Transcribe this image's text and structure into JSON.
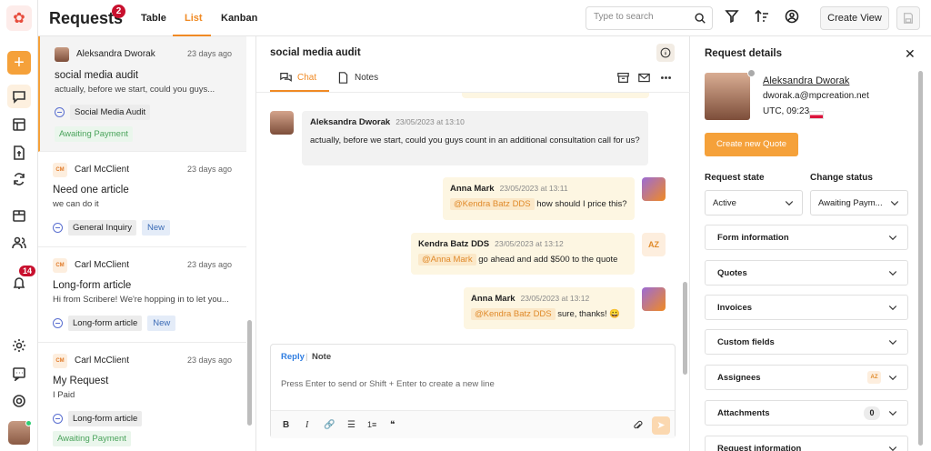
{
  "header": {
    "title": "Requests",
    "title_count": "2",
    "tabs": [
      {
        "label": "Table"
      },
      {
        "label": "List"
      },
      {
        "label": "Kanban"
      }
    ],
    "search_placeholder": "Type to search",
    "create_view_label": "Create View"
  },
  "rail": {
    "notification_count": "14",
    "icons": [
      "logo-icon",
      "plus-icon",
      "chat-icon",
      "layout-icon",
      "invoice-icon",
      "sync-icon",
      "package-icon",
      "users-icon",
      "bell-icon",
      "gear-icon",
      "message-icon",
      "lifebuoy-icon"
    ]
  },
  "requests": [
    {
      "name": "Aleksandra Dworak",
      "ago": "23 days ago",
      "subject": "social media audit",
      "preview": "actually, before we start, could you guys...",
      "category": "Social Media Audit",
      "status": "Awaiting Payment"
    },
    {
      "name": "Carl McClient",
      "avatar": "CM",
      "ago": "23 days ago",
      "subject": "Need one article",
      "preview": "we can do it",
      "category": "General Inquiry",
      "new": "New"
    },
    {
      "name": "Carl McClient",
      "avatar": "CM",
      "ago": "23 days ago",
      "subject": "Long-form article",
      "preview": "Hi from Scribere! We're hopping in to let you...",
      "category": "Long-form article",
      "new": "New"
    },
    {
      "name": "Carl McClient",
      "avatar": "CM",
      "ago": "23 days ago",
      "subject": "My Request",
      "preview": "I Paid",
      "category": "Long-form article",
      "status": "Awaiting Payment"
    }
  ],
  "chat": {
    "title": "social media audit",
    "tabs": [
      {
        "label": "Chat"
      },
      {
        "label": "Notes"
      }
    ],
    "messages": [
      {
        "author": "Aleksandra Dworak",
        "time": "23/05/2023 at 13:10",
        "text": "actually, before we start, could you guys count in an additional consultation call for us?"
      },
      {
        "author": "Anna Mark",
        "time": "23/05/2023 at 13:11",
        "mention": "@Kendra Batz DDS",
        "text": "how should I price this?"
      },
      {
        "author": "Kendra Batz DDS",
        "time": "23/05/2023 at 13:12",
        "mention": "@Anna Mark",
        "text": "go ahead and add $500 to the quote",
        "avatar": "AZ"
      },
      {
        "author": "Anna Mark",
        "time": "23/05/2023 at 13:12",
        "mention": "@Kendra Batz DDS",
        "text": "sure, thanks! 😀"
      }
    ],
    "reply_tab": "Reply",
    "note_tab": "Note",
    "reply_placeholder": "Press Enter to send or Shift + Enter to create a new line",
    "toolbar": [
      "B",
      "I",
      "🔗",
      "☰",
      "1≡",
      "❝"
    ]
  },
  "details": {
    "title": "Request details",
    "name": "Aleksandra Dworak",
    "email": "dworak.a@mpcreation.net",
    "timezone": "UTC, 09:23",
    "create_quote": "Create new Quote",
    "request_state_label": "Request state",
    "request_state_value": "Active",
    "change_status_label": "Change status",
    "change_status_value": "Awaiting Paym...",
    "sections": [
      {
        "label": "Form information"
      },
      {
        "label": "Quotes"
      },
      {
        "label": "Invoices"
      },
      {
        "label": "Custom fields"
      },
      {
        "label": "Assignees",
        "badge": "AZ"
      },
      {
        "label": "Attachments",
        "count": "0"
      },
      {
        "label": "Request information"
      }
    ]
  },
  "colors": {
    "accent": "#f5a13a",
    "badge": "#c8102e",
    "status_green": "#4aa35b",
    "new_blue": "#3b6bb5"
  }
}
